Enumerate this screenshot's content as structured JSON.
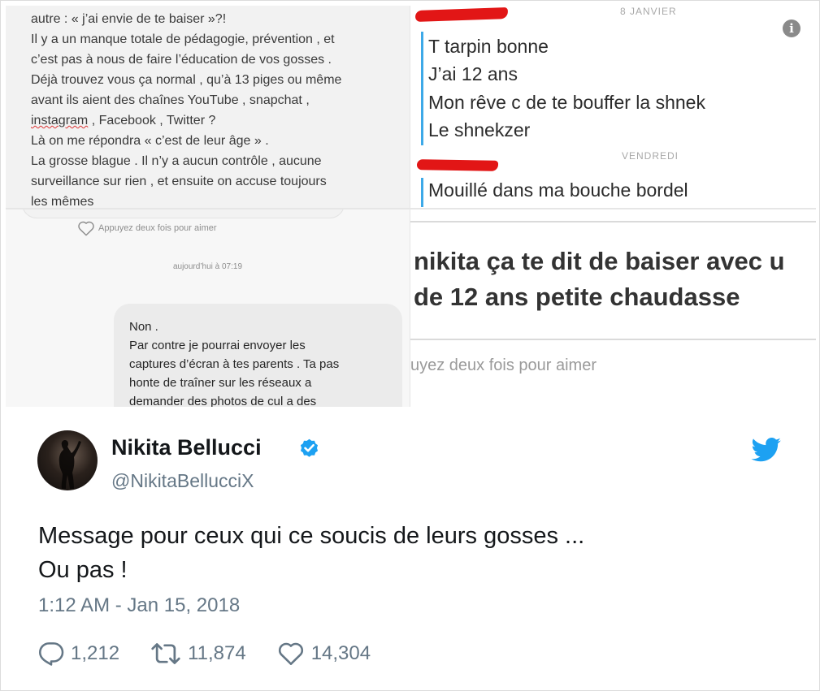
{
  "collage": {
    "note_panel": {
      "lines": [
        "autre : «  j’ai envie de te baiser »?!",
        "Il y a un manque totale de pédagogie, prévention , et",
        "c’est pas à nous de faire l’éducation de vos gosses .",
        "Déjà trouvez vous ça normal , qu’à 13 piges ou même",
        "avant ils aient des chaînes YouTube , snapchat ,",
        "Là on me répondra «  c’est de leur âge » .",
        "La grosse blague . Il n’y a aucun contrôle , aucune",
        "surveillance sur rien , et ensuite on accuse toujours",
        "les mêmes"
      ],
      "insta_line_word": "instagram",
      "insta_line_rest": " , Facebook , Twitter ?"
    },
    "dm_panel": {
      "like_hint": "Appuyez deux fois pour aimer",
      "timestamp": "aujourd’hui à 07:19",
      "message_lines": [
        "Non .",
        "Par contre je pourrai envoyer les",
        "captures d’écran à tes parents . Ta pas",
        "honte de traîner sur les réseaux a",
        "demander des photos de cul a des"
      ]
    },
    "snap_panel": {
      "date1": "8 JANVIER",
      "date2": "VENDREDI",
      "messages_1": [
        "T tarpin bonne",
        "J’ai 12 ans",
        "Mon rêve c de te bouffer la shnek",
        "Le shnekzer"
      ],
      "messages_2": [
        "Mouillé dans ma bouche bordel"
      ]
    },
    "comment_panel": {
      "line1": "nikita ça te dit de baiser avec u",
      "line2": "de 12 ans petite chaudasse",
      "like_hint": "uyez deux fois pour aimer"
    }
  },
  "tweet": {
    "name": "Nikita Bellucci",
    "handle": "@NikitaBellucciX",
    "text_lines": [
      "Message pour ceux qui ce soucis de leurs gosses ...",
      "Ou pas !"
    ],
    "timestamp": "1:12 AM - Jan 15, 2018",
    "replies": "1,212",
    "retweets": "11,874",
    "likes": "14,304",
    "icons": {
      "verified": "verified-badge-icon",
      "platform": "twitter-bird-icon",
      "reply": "reply-icon",
      "retweet": "retweet-icon",
      "like": "heart-icon"
    },
    "colors": {
      "accent": "#1da1f2",
      "muted": "#657786",
      "text": "#14171a"
    }
  }
}
